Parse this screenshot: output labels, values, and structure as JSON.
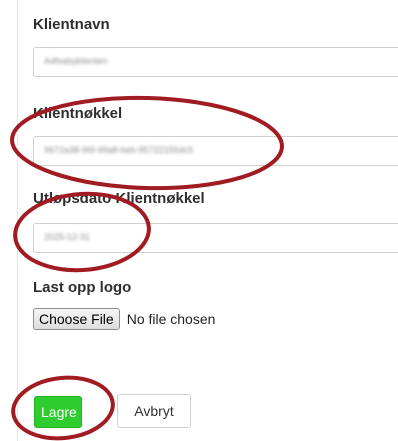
{
  "form": {
    "client_name": {
      "label": "Klientnavn",
      "value": "Adfsabyklienten"
    },
    "client_key": {
      "label": "Klientnøkkel",
      "value": "9672a38-96f-49a8-beb-95722155dc5"
    },
    "key_expiry": {
      "label": "Utløpsdato Klientnøkkel",
      "value": "2025-12-31"
    },
    "logo_upload": {
      "label": "Last opp logo",
      "button_label": "Choose File",
      "status_text": "No file chosen"
    }
  },
  "actions": {
    "save_label": "Lagre",
    "cancel_label": "Avbryt"
  },
  "colors": {
    "primary_button": "#2ecc2e",
    "annotation_circle": "#a11b22"
  }
}
